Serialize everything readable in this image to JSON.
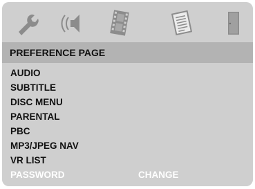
{
  "tabs": [
    {
      "icon": "wrench-icon"
    },
    {
      "icon": "speaker-icon"
    },
    {
      "icon": "film-icon"
    },
    {
      "icon": "document-icon"
    },
    {
      "icon": "door-icon"
    }
  ],
  "header": {
    "title": "PREFERENCE PAGE"
  },
  "menu": {
    "items": [
      {
        "label": "AUDIO"
      },
      {
        "label": "SUBTITLE"
      },
      {
        "label": "DISC MENU"
      },
      {
        "label": "PARENTAL"
      },
      {
        "label": "PBC"
      },
      {
        "label": "MP3/JPEG NAV"
      },
      {
        "label": "VR LIST"
      },
      {
        "label": "PASSWORD",
        "value": "CHANGE"
      }
    ]
  },
  "colors": {
    "screen_bg": "#cfcfcf",
    "header_bg": "#b3b3b3",
    "icon_color": "#8c8c8c",
    "selected_text": "#ffffff"
  }
}
